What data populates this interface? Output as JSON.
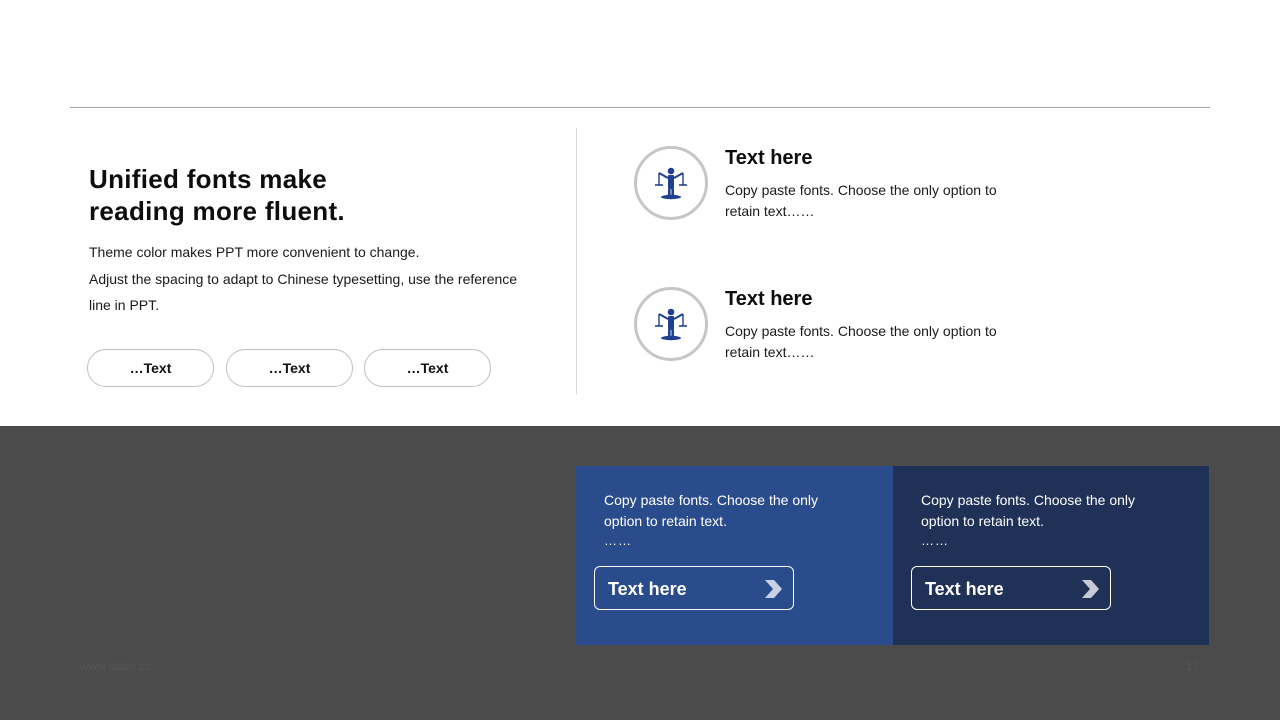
{
  "headline": {
    "line1": "Unified fonts make",
    "line2": "reading more fluent."
  },
  "body": [
    "Theme color makes PPT more convenient  to change.",
    "Adjust the spacing to adapt to Chinese  typesetting, use the reference",
    "line  in  PPT."
  ],
  "pills": [
    "…Text",
    "…Text",
    "…Text"
  ],
  "features": [
    {
      "icon": "justice-scales-icon",
      "title": "Text here",
      "desc": "Copy paste fonts. Choose the only option to retain text……"
    },
    {
      "icon": "justice-scales-icon",
      "title": "Text here",
      "desc": "Copy paste fonts. Choose the only option to retain text……"
    }
  ],
  "cards": [
    {
      "text": "Copy paste fonts. Choose the only option to retain text.",
      "dots": "……",
      "button": "Text here",
      "color": "#2b4c8c"
    },
    {
      "text": "Copy paste fonts. Choose the only option to retain text.",
      "dots": "……",
      "button": "Text here",
      "color": "#203158"
    }
  ],
  "footer": {
    "site": "www.islide.cc",
    "page": "17"
  },
  "colors": {
    "accent_blue": "#2b4c8c",
    "navy": "#203158",
    "band": "#4b4b4b",
    "icon_blue": "#1f3f8f"
  }
}
